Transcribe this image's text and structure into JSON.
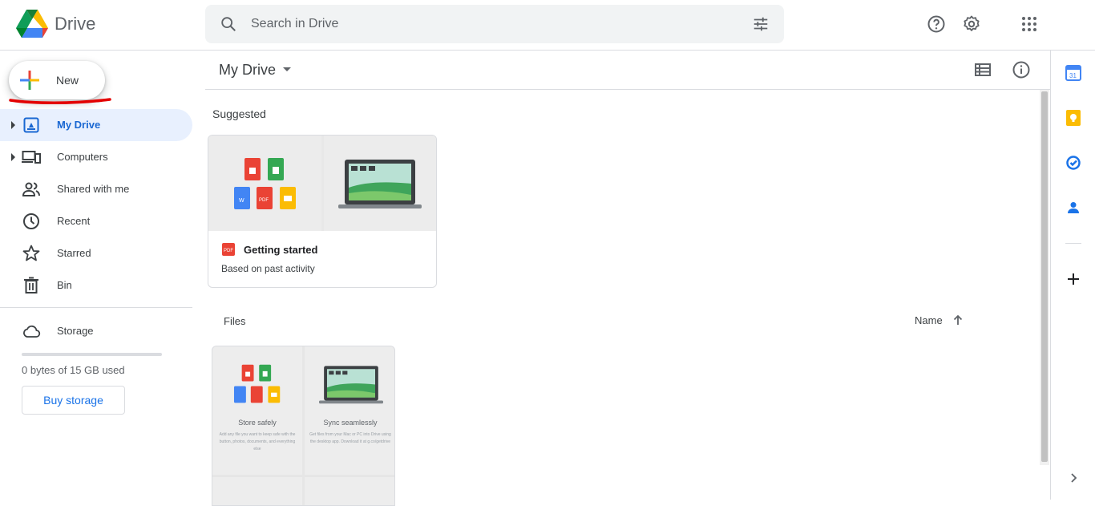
{
  "app": {
    "name": "Drive"
  },
  "search": {
    "placeholder": "Search in Drive"
  },
  "topbar": {
    "icons": [
      "help-icon",
      "settings-icon",
      "apps-grid-icon"
    ]
  },
  "sidebar": {
    "new_label": "New",
    "items": [
      {
        "label": "My Drive",
        "icon": "my-drive-icon",
        "active": true
      },
      {
        "label": "Computers",
        "icon": "computers-icon",
        "active": false
      },
      {
        "label": "Shared with me",
        "icon": "shared-icon",
        "active": false
      },
      {
        "label": "Recent",
        "icon": "clock-icon",
        "active": false
      },
      {
        "label": "Starred",
        "icon": "star-icon",
        "active": false
      },
      {
        "label": "Bin",
        "icon": "trash-icon",
        "active": false
      }
    ],
    "storage_label": "Storage",
    "storage_used": 0.0,
    "storage_text": "0 bytes of 15 GB used",
    "buy_label": "Buy storage"
  },
  "main": {
    "breadcrumb": "My Drive",
    "suggested_title": "Suggested",
    "suggested_card": {
      "name": "Getting started",
      "subtitle": "Based on past activity"
    },
    "files_title": "Files",
    "sort_label": "Name",
    "file_thumb": {
      "left_title": "Store safely",
      "left_desc": "Add any file you want to keep safe with the button, photos, documents, and everything else",
      "right_title": "Sync seamlessly",
      "right_desc": "Get files from your Mac or PC into Drive using the desktop app. Download it at g.co/getdrive"
    }
  },
  "rightbar": {
    "icons": [
      "calendar-icon",
      "keep-icon",
      "tasks-icon",
      "contacts-icon",
      "add-icon",
      "expand-icon"
    ]
  },
  "colors": {
    "accent": "#1a73e8",
    "active_bg": "#e8f0fe",
    "active_text": "#1967d2",
    "annotation": "#e30000"
  }
}
